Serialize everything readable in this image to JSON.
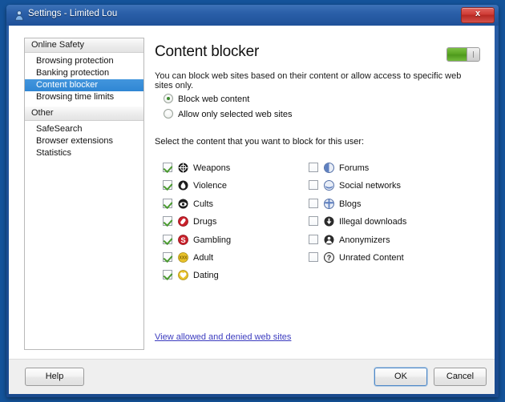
{
  "window": {
    "title": "Settings - Limited Lou",
    "title_icon": "user-icon",
    "close_label": "x"
  },
  "sidebar": {
    "groups": [
      {
        "header": "Online Safety",
        "items": [
          {
            "label": "Browsing protection",
            "selected": false
          },
          {
            "label": "Banking protection",
            "selected": false
          },
          {
            "label": "Content blocker",
            "selected": true
          },
          {
            "label": "Browsing time limits",
            "selected": false
          }
        ]
      },
      {
        "header": "Other",
        "items": [
          {
            "label": "SafeSearch",
            "selected": false
          },
          {
            "label": "Browser extensions",
            "selected": false
          },
          {
            "label": "Statistics",
            "selected": false
          }
        ]
      }
    ]
  },
  "panel": {
    "title": "Content blocker",
    "toggle": {
      "state": "on",
      "name": "content-blocker-toggle"
    },
    "description": "You can block web sites based on their content or allow access to specific web sites only.",
    "radios": [
      {
        "label": "Block web content",
        "selected": true
      },
      {
        "label": "Allow only selected web sites",
        "selected": false
      }
    ],
    "select_label": "Select the content that you want to block for this user:",
    "categories_left": [
      {
        "label": "Weapons",
        "checked": true,
        "icon": "weapons-target-icon"
      },
      {
        "label": "Violence",
        "checked": true,
        "icon": "violence-drop-icon"
      },
      {
        "label": "Cults",
        "checked": true,
        "icon": "cults-eye-icon"
      },
      {
        "label": "Drugs",
        "checked": true,
        "icon": "drugs-pill-icon"
      },
      {
        "label": "Gambling",
        "checked": true,
        "icon": "gambling-dollar-icon"
      },
      {
        "label": "Adult",
        "checked": true,
        "icon": "adult-xxx-icon"
      },
      {
        "label": "Dating",
        "checked": true,
        "icon": "dating-heart-icon"
      }
    ],
    "categories_right": [
      {
        "label": "Forums",
        "checked": false,
        "icon": "forums-icon"
      },
      {
        "label": "Social networks",
        "checked": false,
        "icon": "social-networks-icon"
      },
      {
        "label": "Blogs",
        "checked": false,
        "icon": "blogs-icon"
      },
      {
        "label": "Illegal downloads",
        "checked": false,
        "icon": "illegal-downloads-arrow-icon"
      },
      {
        "label": "Anonymizers",
        "checked": false,
        "icon": "anonymizers-person-icon"
      },
      {
        "label": "Unrated Content",
        "checked": false,
        "icon": "unrated-question-icon"
      }
    ],
    "view_link": "View allowed and denied web sites"
  },
  "buttons": {
    "help": "Help",
    "ok": "OK",
    "cancel": "Cancel"
  },
  "colors": {
    "accent_blue": "#2f87d4",
    "toggle_green": "#5aa524",
    "close_red": "#cf3b35",
    "link": "#3b3bbf",
    "titlebar": "#2a5fa8"
  }
}
